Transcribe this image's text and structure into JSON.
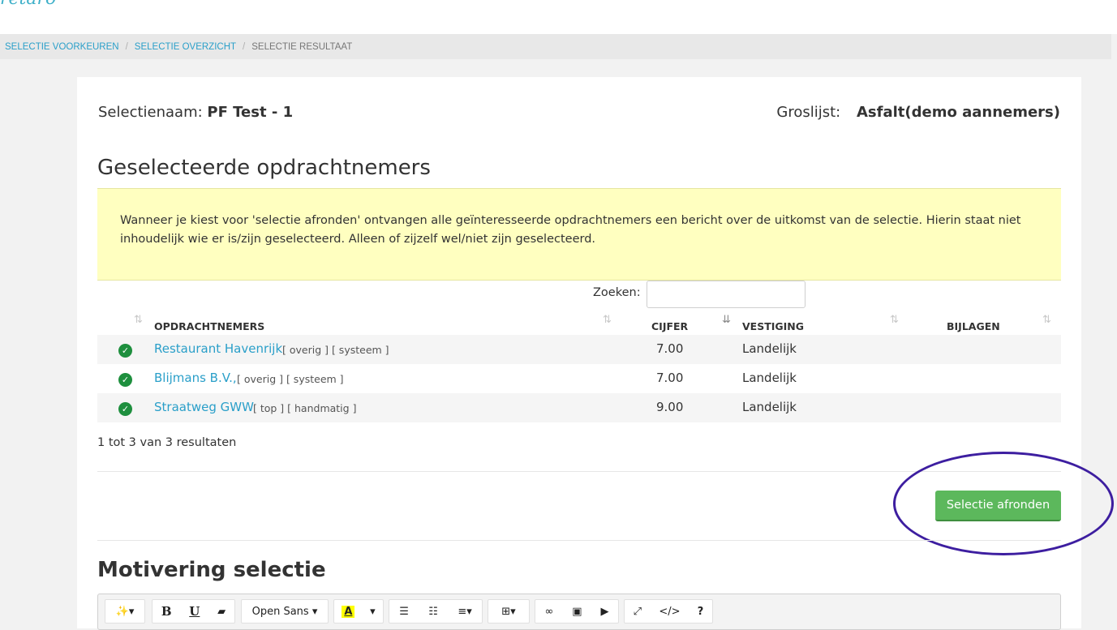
{
  "app": {
    "logo_text": "retaro"
  },
  "breadcrumb": {
    "items": [
      {
        "label": "SELECTIE VOORKEUREN"
      },
      {
        "label": "SELECTIE OVERZICHT"
      },
      {
        "label": "SELECTIE RESULTAAT"
      }
    ],
    "separator": "/"
  },
  "selection": {
    "name_label": "Selectienaam:",
    "name_value": "PF Test - 1",
    "list_label": "Groslijst:",
    "list_value": "Asfalt(demo aannemers)"
  },
  "section_title": "Geselecteerde opdrachtnemers",
  "notice": "Wanneer je kiest voor 'selectie afronden' ontvangen alle geïnteresseerde opdrachtnemers een bericht over de uitkomst van de selectie. Hierin staat niet inhoudelijk wie er is/zijn geselecteerd. Alleen of zijzelf wel/niet zijn geselecteerd.",
  "search": {
    "label": "Zoeken:",
    "value": ""
  },
  "table": {
    "columns": [
      "OPDRACHTNEMERS",
      "CIJFER",
      "VESTIGING",
      "BIJLAGEN"
    ],
    "rows": [
      {
        "name": "Restaurant Havenrijk",
        "tags": "[ overig ] [ systeem ]",
        "score": "7.00",
        "location": "Landelijk",
        "attachments": ""
      },
      {
        "name": "Blijmans B.V.,",
        "tags": "[ overig ] [ systeem ]",
        "score": "7.00",
        "location": "Landelijk",
        "attachments": ""
      },
      {
        "name": "Straatweg GWW",
        "tags": "[ top ] [ handmatig ]",
        "score": "9.00",
        "location": "Landelijk",
        "attachments": ""
      }
    ],
    "results_text": "1 tot 3 van 3 resultaten",
    "status_icon": "check-circle-icon",
    "status_color": "#1e8f3e"
  },
  "finish_button": {
    "label": "Selectie afronden",
    "color": "#5cb85c"
  },
  "highlight_color": "#3d1ea0",
  "motivation": {
    "title": "Motivering selectie",
    "toolbar": {
      "font": "Open Sans",
      "buttons": [
        "magic-icon",
        "bold-icon",
        "underline-icon",
        "eraser-icon",
        "font-select",
        "text-color-icon",
        "bullet-list-icon",
        "numbered-list-icon",
        "align-icon",
        "table-icon",
        "link-icon",
        "image-icon",
        "video-icon",
        "fullscreen-icon",
        "code-view-icon",
        "help-icon"
      ]
    }
  },
  "colors": {
    "link": "#2a9fc9",
    "notice_bg": "#ffffc0",
    "accent_green": "#5cb85c"
  }
}
